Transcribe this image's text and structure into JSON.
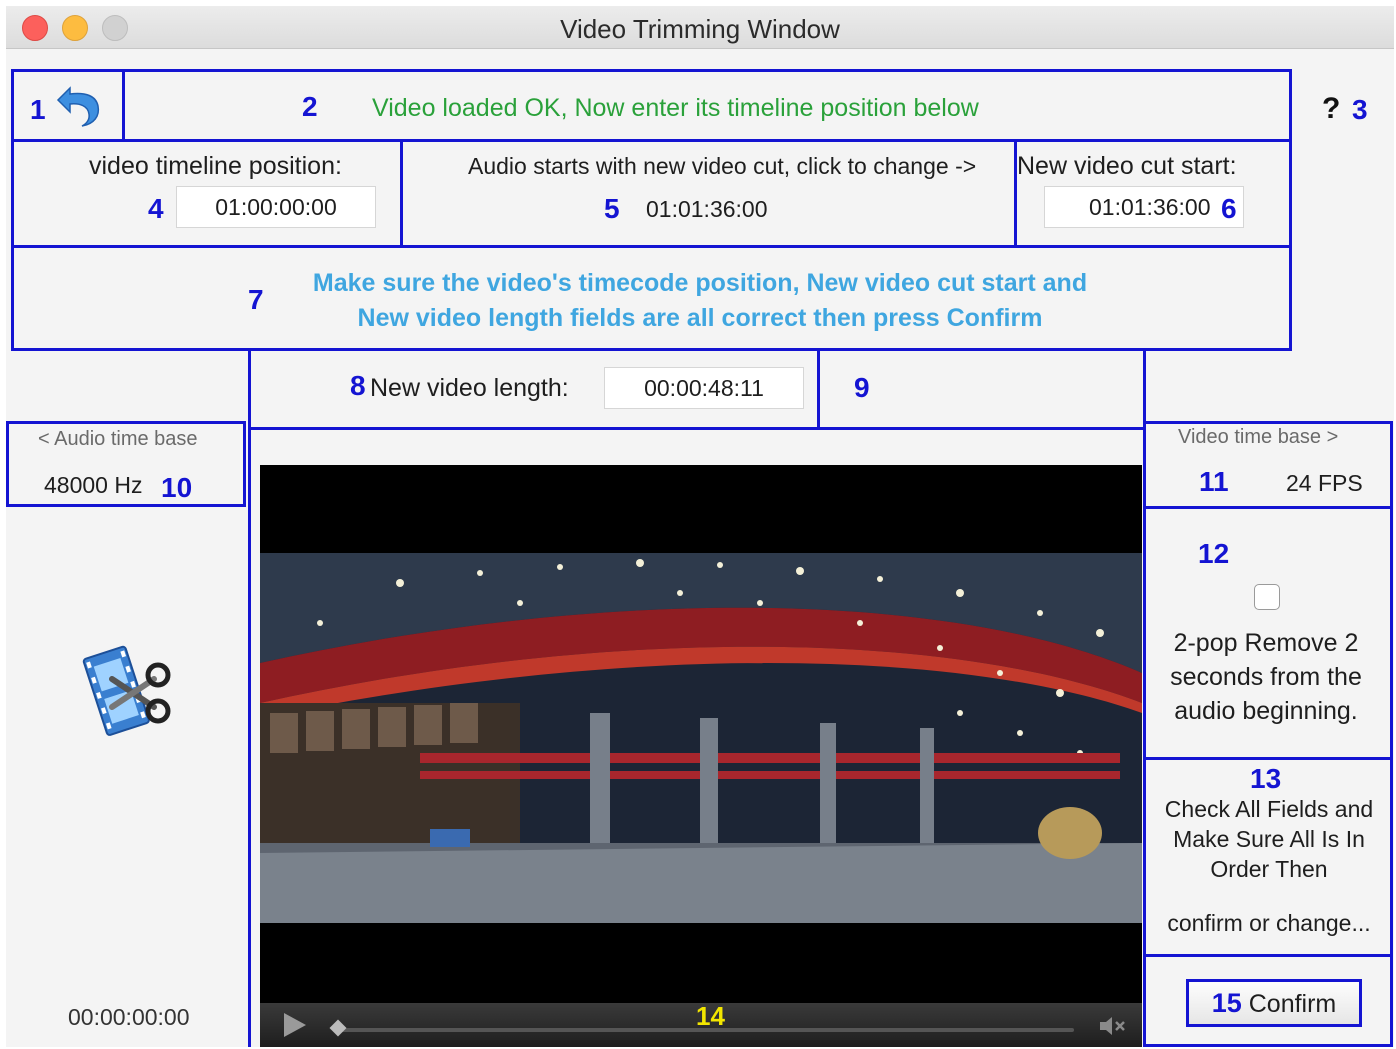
{
  "window": {
    "title": "Video Trimming Window"
  },
  "header": {
    "undo_num": "1",
    "status_num": "2",
    "status_message": "Video loaded OK, Now enter its timeline position below",
    "help_symbol": "?",
    "help_num": "3"
  },
  "timeline": {
    "label": "video timeline position:",
    "num": "4",
    "value": "01:00:00:00"
  },
  "audio_cut": {
    "label": "Audio starts with new video cut, click to change ->",
    "num": "5",
    "value": "01:01:36:00"
  },
  "cut_start": {
    "label": "New video cut start:",
    "num": "6",
    "value": "01:01:36:00"
  },
  "instructions": {
    "num": "7",
    "line1": "Make sure the video's timecode position, New video cut start and",
    "line2": "New video length fields are all correct then press Confirm"
  },
  "length": {
    "num": "8",
    "label": "New video length:",
    "value": "00:00:48:11"
  },
  "box9": {
    "num": "9"
  },
  "audio_base": {
    "label": "< Audio time base",
    "value": "48000 Hz",
    "num": "10"
  },
  "video_base": {
    "label": "Video time base >",
    "num": "11",
    "value": "24 FPS"
  },
  "two_pop": {
    "num": "12",
    "checked": false,
    "line1": "2-pop Remove 2",
    "line2": "seconds from the",
    "line3": "audio beginning."
  },
  "check_note": {
    "num": "13",
    "line1": "Check All Fields and",
    "line2": "Make Sure All Is In",
    "line3": "Order Then",
    "line4": "confirm or change..."
  },
  "player": {
    "num": "14"
  },
  "confirm": {
    "num": "15",
    "label": "Confirm"
  },
  "left_timecode": "00:00:00:00",
  "icons": [
    "undo-arrow-icon",
    "help-icon",
    "film-scissors-icon",
    "play-icon",
    "mute-icon"
  ],
  "colors": {
    "accent_blue": "#1414d2",
    "status_green": "#2aa13a",
    "instruction_blue": "#3fa6e0",
    "number_yellow": "#f2e600"
  }
}
